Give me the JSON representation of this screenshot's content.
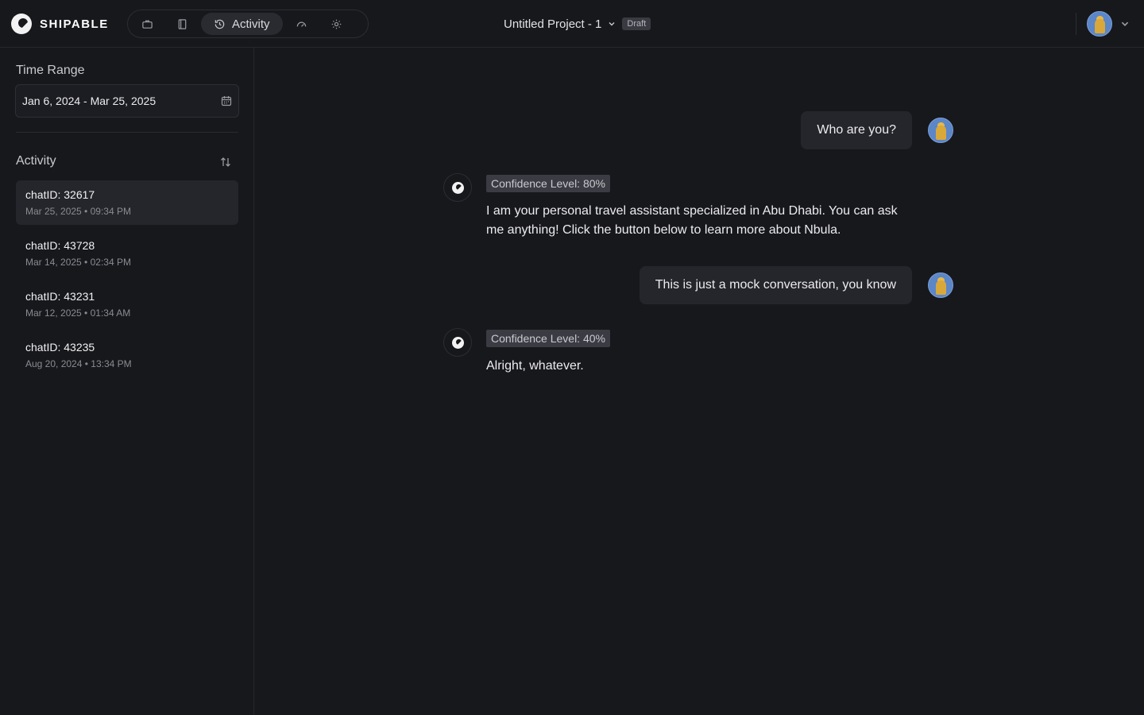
{
  "brand": {
    "name": "SHIPABLE"
  },
  "nav": {
    "items": [
      {
        "icon": "briefcase-icon",
        "label": ""
      },
      {
        "icon": "book-icon",
        "label": ""
      },
      {
        "icon": "history-icon",
        "label": "Activity"
      },
      {
        "icon": "gauge-icon",
        "label": ""
      },
      {
        "icon": "gear-icon",
        "label": ""
      }
    ]
  },
  "project": {
    "title": "Untitled Project - 1",
    "status": "Draft"
  },
  "sidebar": {
    "time_range_label": "Time Range",
    "date_range": "Jan 6, 2024 - Mar 25, 2025",
    "activity_label": "Activity",
    "chats": [
      {
        "id": "chatID: 32617",
        "date": "Mar 25, 2025",
        "time": "09:34 PM"
      },
      {
        "id": "chatID: 43728",
        "date": "Mar 14, 2025",
        "time": "02:34 PM"
      },
      {
        "id": "chatID: 43231",
        "date": "Mar 12, 2025",
        "time": "01:34 AM"
      },
      {
        "id": "chatID: 43235",
        "date": "Aug 20, 2024",
        "time": "13:34 PM"
      }
    ]
  },
  "conversation": {
    "messages": [
      {
        "role": "user",
        "text": "Who are you?"
      },
      {
        "role": "bot",
        "confidence": "Confidence Level: 80%",
        "text": "I am your personal travel assistant specialized in Abu Dhabi. You can ask me anything! Click the button below to learn more about Nbula."
      },
      {
        "role": "user",
        "text": "This is just a mock conversation, you know"
      },
      {
        "role": "bot",
        "confidence": "Confidence Level: 40%",
        "text": "Alright, whatever."
      }
    ]
  }
}
